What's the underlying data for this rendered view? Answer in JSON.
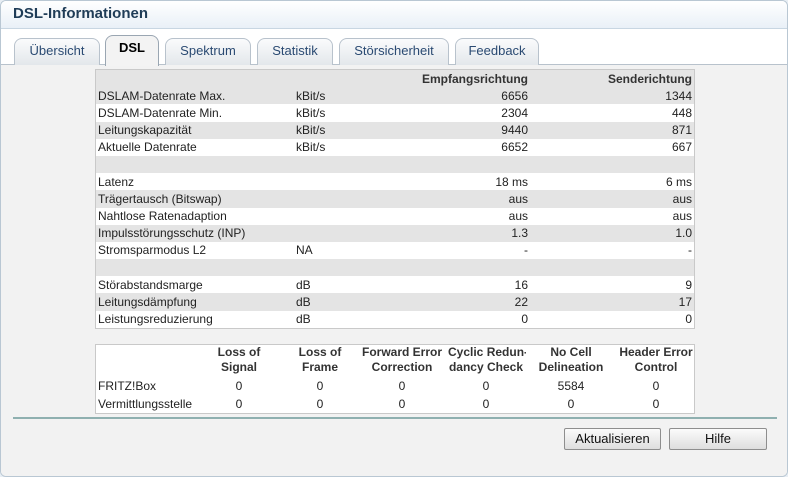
{
  "window": {
    "title": "DSL-Informationen"
  },
  "tabs": [
    {
      "label": "Übersicht"
    },
    {
      "label": "DSL",
      "active": true
    },
    {
      "label": "Spektrum"
    },
    {
      "label": "Statistik"
    },
    {
      "label": "Störsicherheit"
    },
    {
      "label": "Feedback"
    }
  ],
  "dsl_table": {
    "headers": {
      "label": "",
      "unit": "",
      "down": "Empfangsrichtung",
      "up": "Senderichtung"
    },
    "rows": [
      {
        "label": "DSLAM-Datenrate Max.",
        "unit": "kBit/s",
        "down": "6656",
        "up": "1344"
      },
      {
        "label": "DSLAM-Datenrate Min.",
        "unit": "kBit/s",
        "down": "2304",
        "up": "448"
      },
      {
        "label": "Leitungskapazität",
        "unit": "kBit/s",
        "down": "9440",
        "up": "871"
      },
      {
        "label": "Aktuelle Datenrate",
        "unit": "kBit/s",
        "down": "6652",
        "up": "667"
      },
      {
        "label": "",
        "unit": "",
        "down": "",
        "up": ""
      },
      {
        "label": "Latenz",
        "unit": "",
        "down": "18 ms",
        "up": "6 ms"
      },
      {
        "label": "Trägertausch (Bitswap)",
        "unit": "",
        "down": "aus",
        "up": "aus"
      },
      {
        "label": "Nahtlose Ratenadaption",
        "unit": "",
        "down": "aus",
        "up": "aus"
      },
      {
        "label": "Impulsstörungsschutz (INP)",
        "unit": "",
        "down": "1.3",
        "up": "1.0"
      },
      {
        "label": "Stromsparmodus L2",
        "unit": "NA",
        "down": "-",
        "up": "-"
      },
      {
        "label": "",
        "unit": "",
        "down": "",
        "up": ""
      },
      {
        "label": "Störabstandsmarge",
        "unit": "dB",
        "down": "16",
        "up": "9"
      },
      {
        "label": "Leitungsdämpfung",
        "unit": "dB",
        "down": "22",
        "up": "17"
      },
      {
        "label": "Leistungsreduzierung",
        "unit": "dB",
        "down": "0",
        "up": "0"
      }
    ]
  },
  "error_table": {
    "headers": [
      {
        "line1": "Loss of",
        "line2": "Signal"
      },
      {
        "line1": "Loss of",
        "line2": "Frame"
      },
      {
        "line1": "Forward Error",
        "line2": "Correction"
      },
      {
        "line1": "Cyclic Redun-",
        "line2": "dancy Check"
      },
      {
        "line1": "No Cell",
        "line2": "Delineation"
      },
      {
        "line1": "Header Error",
        "line2": "Control"
      }
    ],
    "rows": [
      {
        "label": "FRITZ!Box",
        "values": [
          "0",
          "0",
          "0",
          "0",
          "5584",
          "0"
        ]
      },
      {
        "label": "Vermittlungsstelle",
        "values": [
          "0",
          "0",
          "0",
          "0",
          "0",
          "0"
        ]
      }
    ]
  },
  "buttons": {
    "refresh": "Aktualisieren",
    "help": "Hilfe"
  }
}
